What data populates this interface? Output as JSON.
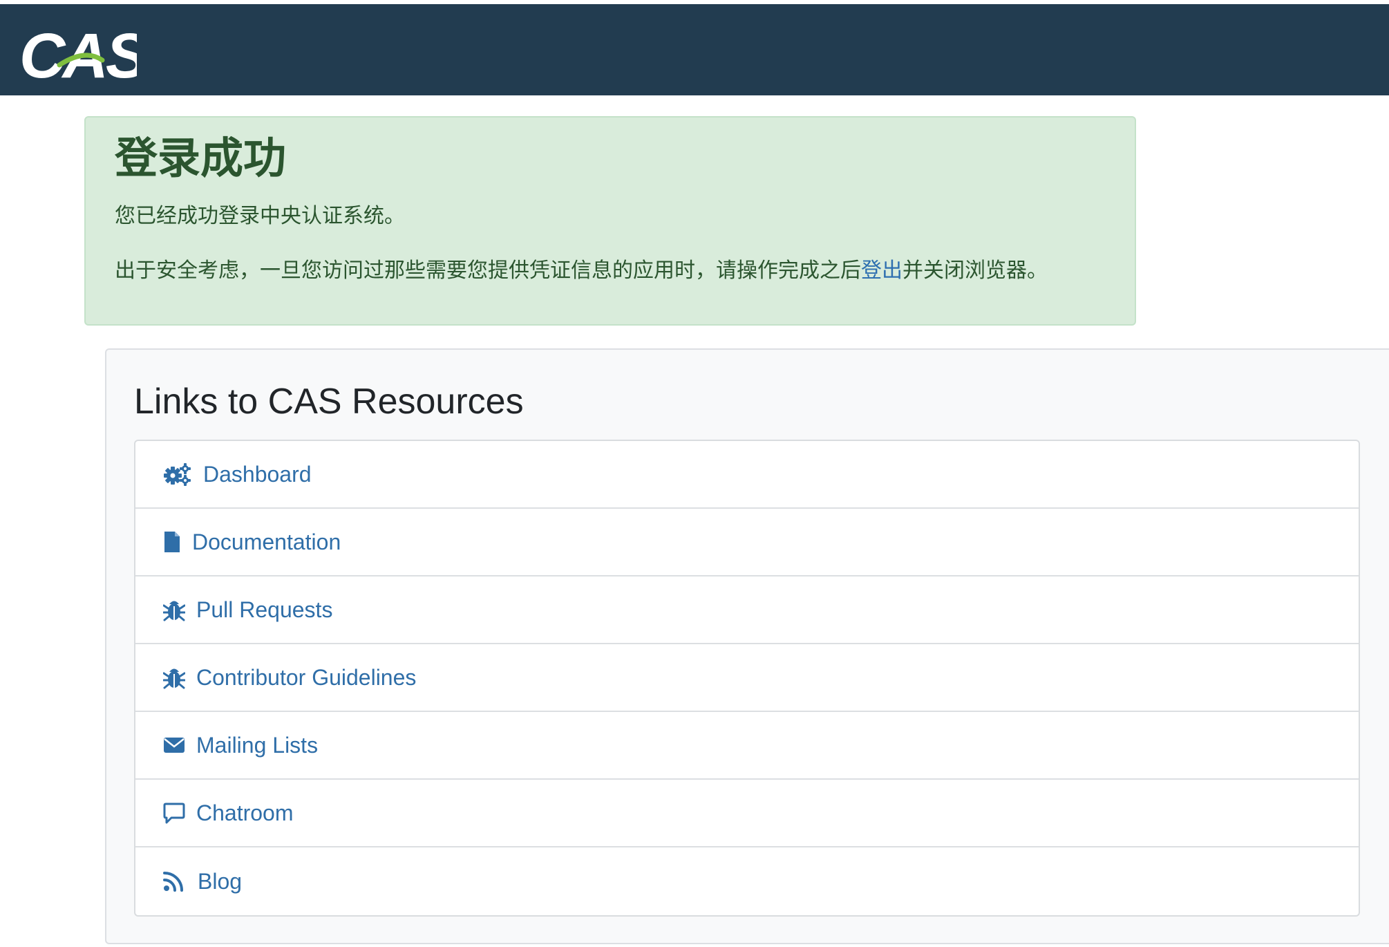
{
  "header": {
    "logo_text": "CAS",
    "background_color": "#223c50"
  },
  "alert": {
    "title": "登录成功",
    "line1": "您已经成功登录中央认证系统。",
    "line2_before": "出于安全考虑，一旦您访问过那些需要您提供凭证信息的应用时，请操作完成之后",
    "logout_link": "登出",
    "line2_after": "并关闭浏览器。",
    "background_color": "#d9ecdb",
    "text_color": "#2b552f"
  },
  "resources": {
    "title": "Links to CAS Resources",
    "link_color": "#2f6ea8",
    "items": [
      {
        "label": "Dashboard",
        "icon": "gears-icon"
      },
      {
        "label": "Documentation",
        "icon": "file-icon"
      },
      {
        "label": "Pull Requests",
        "icon": "bug-icon"
      },
      {
        "label": "Contributor Guidelines",
        "icon": "bug-icon"
      },
      {
        "label": "Mailing Lists",
        "icon": "envelope-icon"
      },
      {
        "label": "Chatroom",
        "icon": "chat-bubble-icon"
      },
      {
        "label": "Blog",
        "icon": "rss-icon"
      }
    ]
  }
}
